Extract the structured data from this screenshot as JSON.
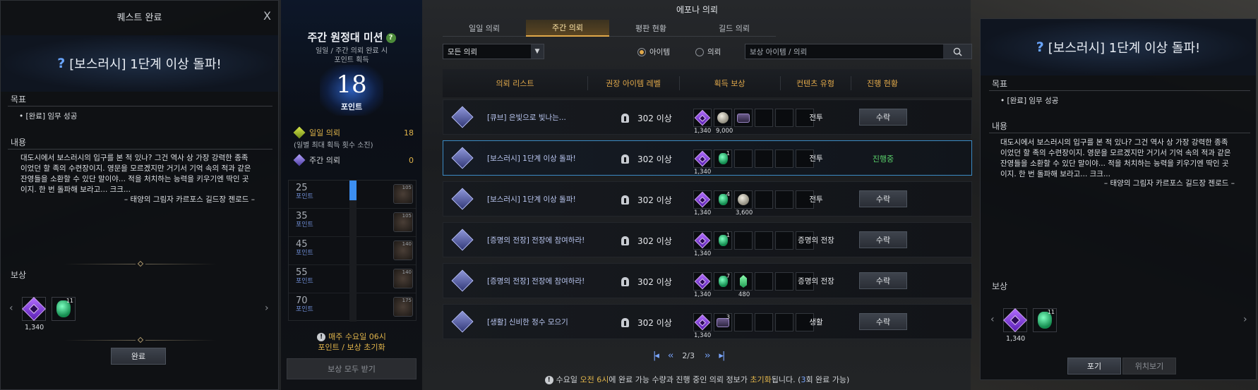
{
  "left_panel": {
    "header": "퀘스트 완료",
    "close": "X",
    "quest_title": "[보스러시] 1단계 이상 돌파!",
    "goal_label": "목표",
    "goal_item": "• [완료] 임무 성공",
    "content_label": "내용",
    "content_text": "대도시에서 보스러시의 입구를 본 적 있나? 그건 역사 상 가장 강력한 종족이었던 할 족의 수련장이지. 영문을 모르겠지만 거기서 기억 속의 적과 같은 잔영들을 소환할 수 있단 말이야... 적을 처치하는 능력을 키우기엔 딱인 곳이지. 한 번 돌파해 보라고... 크크...",
    "signature": "– 태양의 그림자 카르포스 길드장 젠로드 –",
    "reward_label": "보상",
    "reward_qty": "1,340",
    "reward_stack": "11",
    "complete_button": "완료"
  },
  "mission": {
    "title": "주간 원정대 미션",
    "subtitle_line1": "일일 / 주간 의뢰 완료 시",
    "subtitle_line2": "포인트 획득",
    "points": "18",
    "points_label": "포인트",
    "daily_label": "일일 의뢰",
    "daily_value": "18",
    "daily_note": "(일별 최대 획득 횟수 소진)",
    "weekly_label": "주간 의뢰",
    "weekly_value": "0",
    "tiers": [
      {
        "points": "25",
        "unit": "포인트",
        "badge": "105"
      },
      {
        "points": "35",
        "unit": "포인트",
        "badge": "105"
      },
      {
        "points": "45",
        "unit": "포인트",
        "badge": "140"
      },
      {
        "points": "55",
        "unit": "포인트",
        "badge": "140"
      },
      {
        "points": "70",
        "unit": "포인트",
        "badge": "175"
      }
    ],
    "reset_line1": "매주 수요일 06시",
    "reset_line2": "포인트 / 보상 초기화",
    "claim_all": "보상 모두 받기"
  },
  "main": {
    "title": "에포나 의뢰",
    "tabs": [
      "일일 의뢰",
      "주간 의뢰",
      "평판 현황",
      "길드 의뢰"
    ],
    "active_tab": 1,
    "filter_select": "모든 의뢰",
    "radio_item": "아이템",
    "radio_quest": "의뢰",
    "search_placeholder": "보상 아이템 / 의뢰",
    "columns": [
      "의뢰 리스트",
      "권장 아이템 레벨",
      "획득 보상",
      "컨텐츠 유형",
      "진행 현황"
    ],
    "rows": [
      {
        "title": "[큐브] 은빛으로 빛나는...",
        "level": "302 이상",
        "q1": "1,340",
        "q2": "9,000",
        "stack2": "",
        "type": "전투",
        "action": "수락"
      },
      {
        "title": "[보스러시] 1단계 이상 돌파!",
        "level": "302 이상",
        "q1": "1,340",
        "q2": "",
        "stack2": "1",
        "type": "전투",
        "action": "진행중"
      },
      {
        "title": "[보스러시] 1단계 이상 돌파!",
        "level": "302 이상",
        "q1": "1,340",
        "q2": "3,600",
        "stack2": "4",
        "type": "전투",
        "action": "수락"
      },
      {
        "title": "[증명의 전장] 전장에 참여하라!",
        "level": "302 이상",
        "q1": "1,340",
        "q2": "",
        "stack2": "1",
        "type": "증명의 전장",
        "action": "수락"
      },
      {
        "title": "[증명의 전장] 전장에 참여하라!",
        "level": "302 이상",
        "q1": "1,340",
        "q2": "480",
        "stack2": "7",
        "type": "증명의 전장",
        "action": "수락"
      },
      {
        "title": "[생활] 신비한 정수 모으기",
        "level": "302 이상",
        "q1": "1,340",
        "q2": "",
        "stack2": "3",
        "type": "생활",
        "action": "수락"
      }
    ],
    "page": "2/3",
    "footer_pre": "수요일",
    "footer_time": "오전 6시",
    "footer_mid": "에 완료 가능 수량과 진행 중인 의뢰 정보가 ",
    "footer_reset": "초기화",
    "footer_post": "됩니다. (",
    "footer_count": "3",
    "footer_end": "회 완료 가능)"
  },
  "right_panel": {
    "quest_title": "[보스러시] 1단계 이상 돌파!",
    "goal_label": "목표",
    "goal_item": "• [완료] 임무 성공",
    "content_label": "내용",
    "content_text": "대도시에서 보스러시의 입구를 본 적 있나? 그건 역사 상 가장 강력한 종족이었던 할 족의 수련장이지. 영문을 모르겠지만 거기서 기억 속의 적과 같은 잔영들을 소환할 수 있단 말이야... 적을 처치하는 능력을 키우기엔 딱인 곳이지. 한 번 돌파해 보라고... 크크...",
    "signature": "– 태양의 그림자 카르포스 길드장 젠로드 –",
    "reward_label": "보상",
    "reward_qty": "1,340",
    "reward_stack": "11",
    "abandon_button": "포기",
    "locate_button": "위치보기"
  }
}
